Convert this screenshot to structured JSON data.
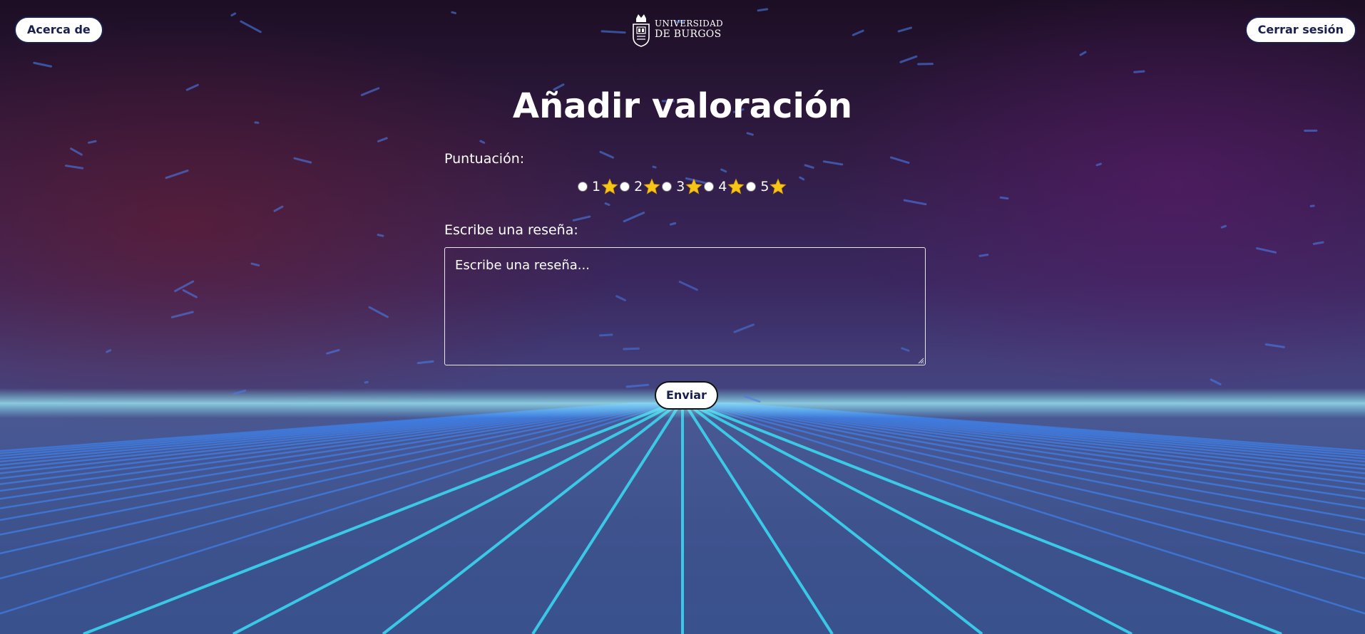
{
  "header": {
    "about_label": "Acerca de",
    "logout_label": "Cerrar sesión",
    "logo": {
      "line1": "UNIVERSIDAD",
      "line2": "DE BURGOS",
      "icon": "university-crest-icon"
    }
  },
  "main": {
    "title": "Añadir valoración",
    "score_label": "Puntuación:",
    "rating_options": [
      {
        "value": "1",
        "icon": "star-icon"
      },
      {
        "value": "2",
        "icon": "star-icon"
      },
      {
        "value": "3",
        "icon": "star-icon"
      },
      {
        "value": "4",
        "icon": "star-icon"
      },
      {
        "value": "5",
        "icon": "star-icon"
      }
    ],
    "review_label": "Escribe una reseña:",
    "review_placeholder": "Escribe una reseña...",
    "review_value": "",
    "submit_label": "Enviar"
  },
  "colors": {
    "button_text": "#1a1f4e",
    "button_bg": "#ffffff",
    "star": "#f5c518",
    "grid_line": "#3ad6f0"
  }
}
